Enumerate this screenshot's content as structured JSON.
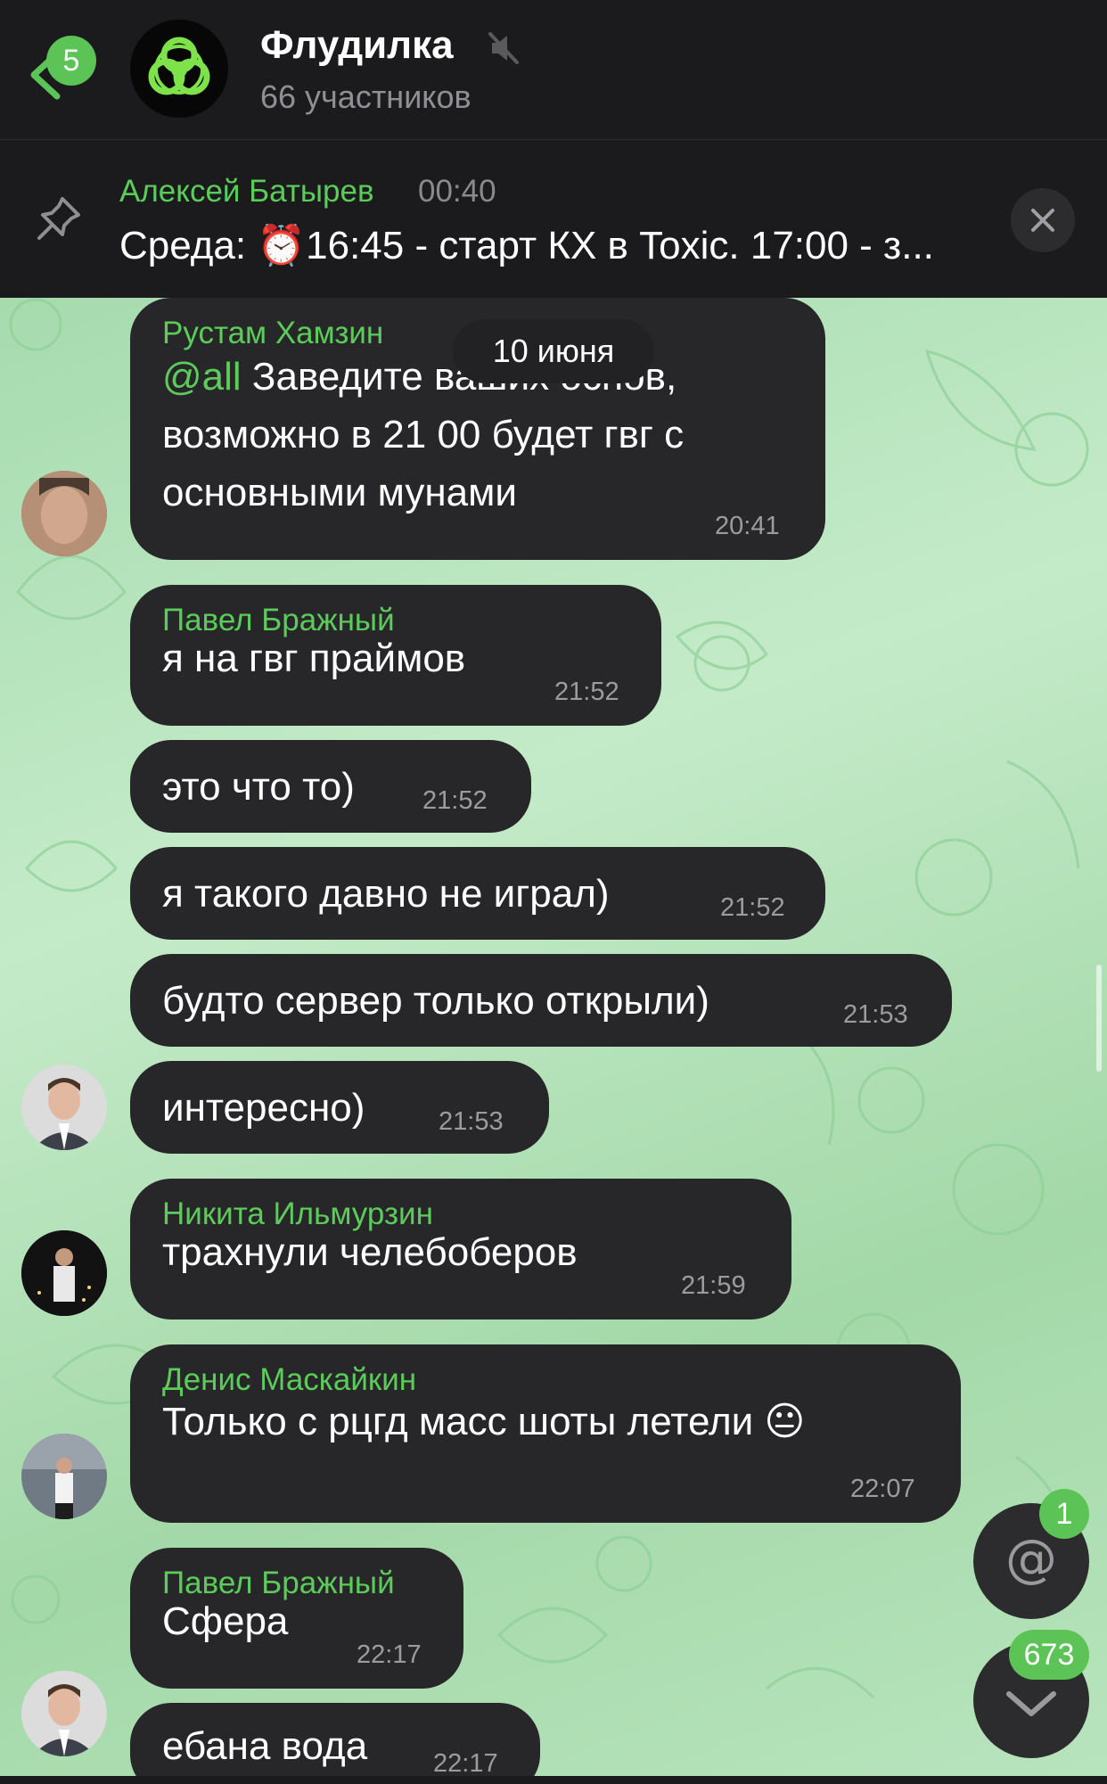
{
  "header": {
    "back_badge": "5",
    "title": "Флудилка",
    "subtitle": "66 участников",
    "back_icon": "chevron-left-icon",
    "mute_icon": "muted-speaker-icon",
    "avatar_icon": "biohazard-icon"
  },
  "pinned": {
    "author": "Алексей Батырев",
    "time": "00:40",
    "text": "Среда: ⏰16:45 - старт КХ в Toxic. 17:00 - з..."
  },
  "date_separator": "10 июня",
  "messages": [
    {
      "sender": "Рустам Хамзин",
      "mention": "@all",
      "line1": " Заведите ваших основ,",
      "line2": "возможно в 21 00 будет гвг с",
      "line3": "основными мунами",
      "time": "20:41"
    },
    {
      "sender": "Павел Бражный",
      "text": "я на гвг праймов",
      "time": "21:52"
    },
    {
      "text": "это что то)",
      "time": "21:52"
    },
    {
      "text": "я такого давно не играл)",
      "time": "21:52"
    },
    {
      "text": "будто сервер только открыли)",
      "time": "21:53"
    },
    {
      "text": "интересно)",
      "time": "21:53"
    },
    {
      "sender": "Никита Ильмурзин",
      "text": "трахнули челебоберов",
      "time": "21:59"
    },
    {
      "sender": "Денис Маскайкин",
      "text": "Только с рцгд масс шоты летели 😐",
      "time": "22:07"
    },
    {
      "sender": "Павел Бражный",
      "text": "Сфера",
      "time": "22:17"
    },
    {
      "text": "ебана вода",
      "time": "22:17"
    }
  ],
  "fabs": {
    "mentions_badge": "1",
    "unread_badge": "673",
    "mentions_icon": "at-sign-icon",
    "scroll_icon": "chevron-down-icon"
  },
  "colors": {
    "accent": "#5cc456",
    "sender_name": "#5bcc59",
    "bubble": "#272729",
    "header_bg": "#1b1b1d"
  }
}
